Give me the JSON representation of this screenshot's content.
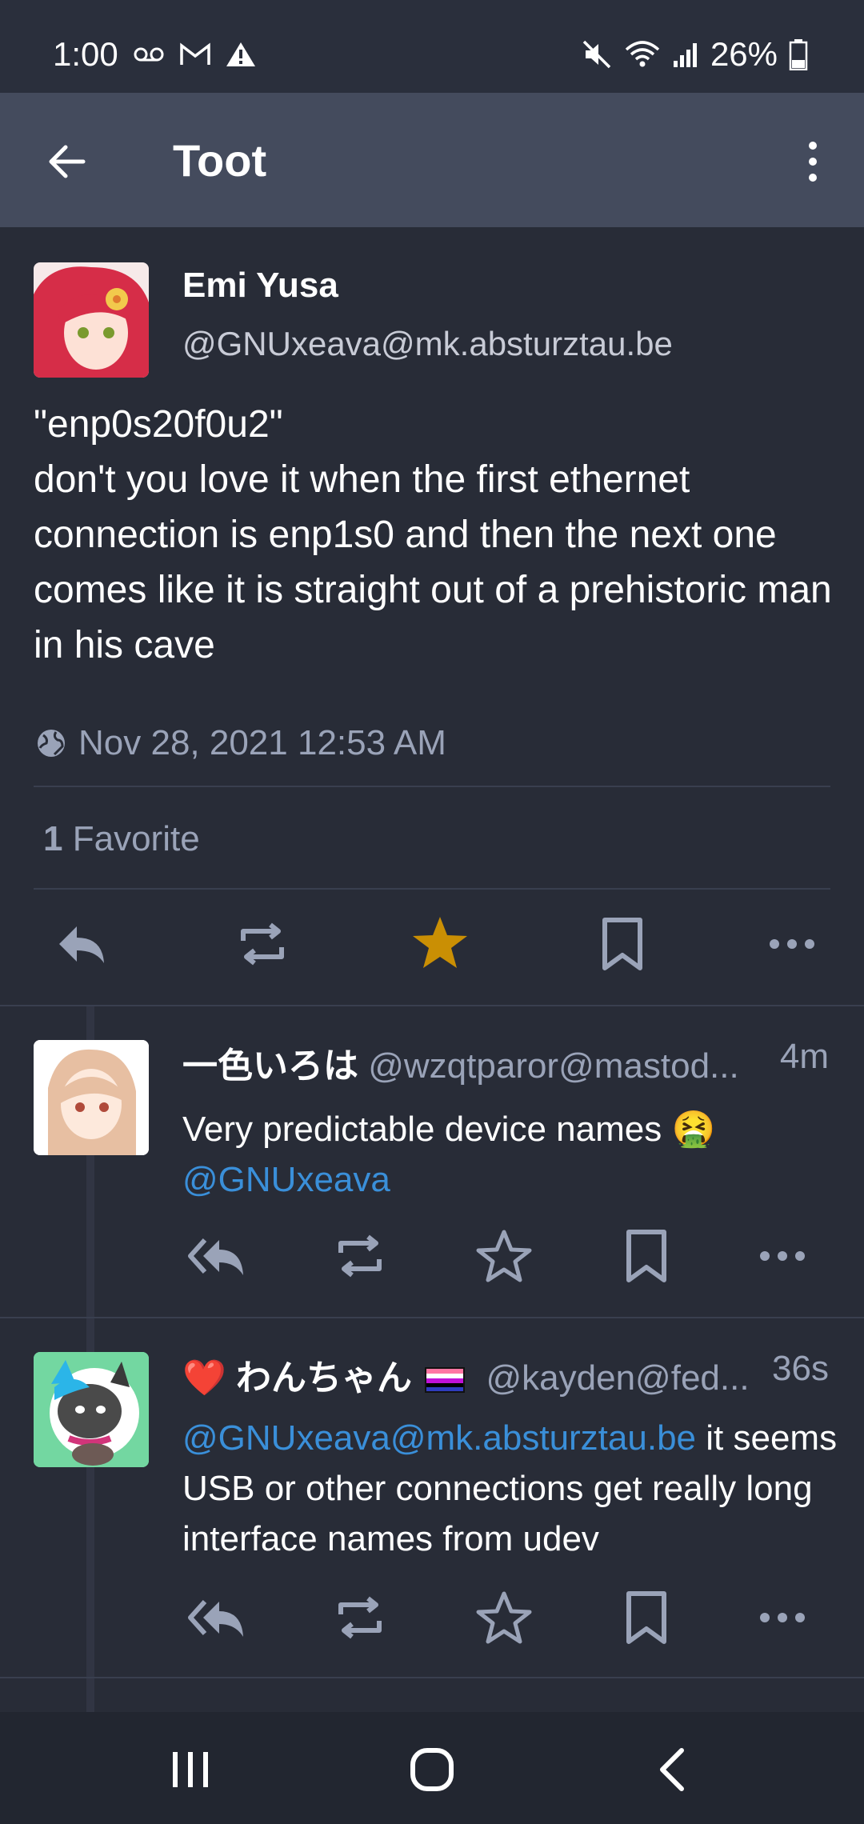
{
  "status_bar": {
    "time": "1:00",
    "battery": "26%",
    "left_icons": [
      "voicemail-icon",
      "gmail-icon",
      "warning-icon"
    ],
    "right_icons": [
      "mute-icon",
      "wifi-icon",
      "signal-icon",
      "battery-icon"
    ]
  },
  "app_bar": {
    "title": "Toot"
  },
  "status": {
    "display_name": "Emi Yusa",
    "acct": "@GNUxeava@mk.absturztau.be",
    "content_lines": [
      "\"enp0s20f0u2\"",
      "don't you love it when the first ethernet connection is enp1s0 and then the next one comes like it is straight out of a prehistoric man in his cave"
    ],
    "timestamp": "Nov 28, 2021 12:53 AM",
    "favorites_count": "1",
    "favorites_label": "Favorite"
  },
  "replies": [
    {
      "display_name": "一色いろは",
      "acct": "@wzqtparor@mastod...",
      "time": "4m",
      "text": "Very predictable device names 🤮",
      "mention": "@GNUxeava"
    },
    {
      "display_name_prefix": "❤️",
      "display_name": "わんちゃん",
      "acct": "@kayden@fed...",
      "time": "36s",
      "mention": "@GNUxeava@mk.absturztau.be",
      "text": " it seems USB or other connections get really long interface names from udev"
    }
  ],
  "colors": {
    "background": "#282c37",
    "app_bar": "#444b5d",
    "favourite_active": "#ca8f04",
    "mention": "#3a8fd9",
    "muted": "#9aa3b8"
  }
}
